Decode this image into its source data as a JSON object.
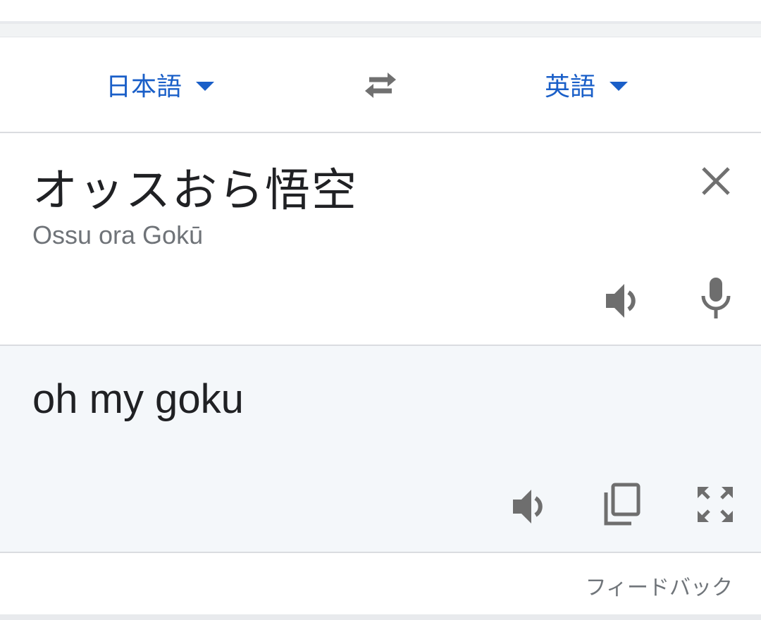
{
  "languages": {
    "source": "日本語",
    "target": "英語"
  },
  "input": {
    "text": "オッスおら悟空",
    "romanization": "Ossu ora Gokū"
  },
  "output": {
    "text": "oh my goku"
  },
  "footer": {
    "feedback": "フィードバック"
  },
  "icons": {
    "swap": "swap-icon",
    "clear": "close-icon",
    "speak": "volume-icon",
    "mic": "microphone-icon",
    "copy": "copy-icon",
    "fullscreen": "fullscreen-icon",
    "dropdown": "caret-down-icon"
  },
  "colors": {
    "accent": "#1a5fc8",
    "text": "#202124",
    "muted": "#6f7378",
    "icon": "#757575",
    "output_bg": "#f4f7fa"
  }
}
